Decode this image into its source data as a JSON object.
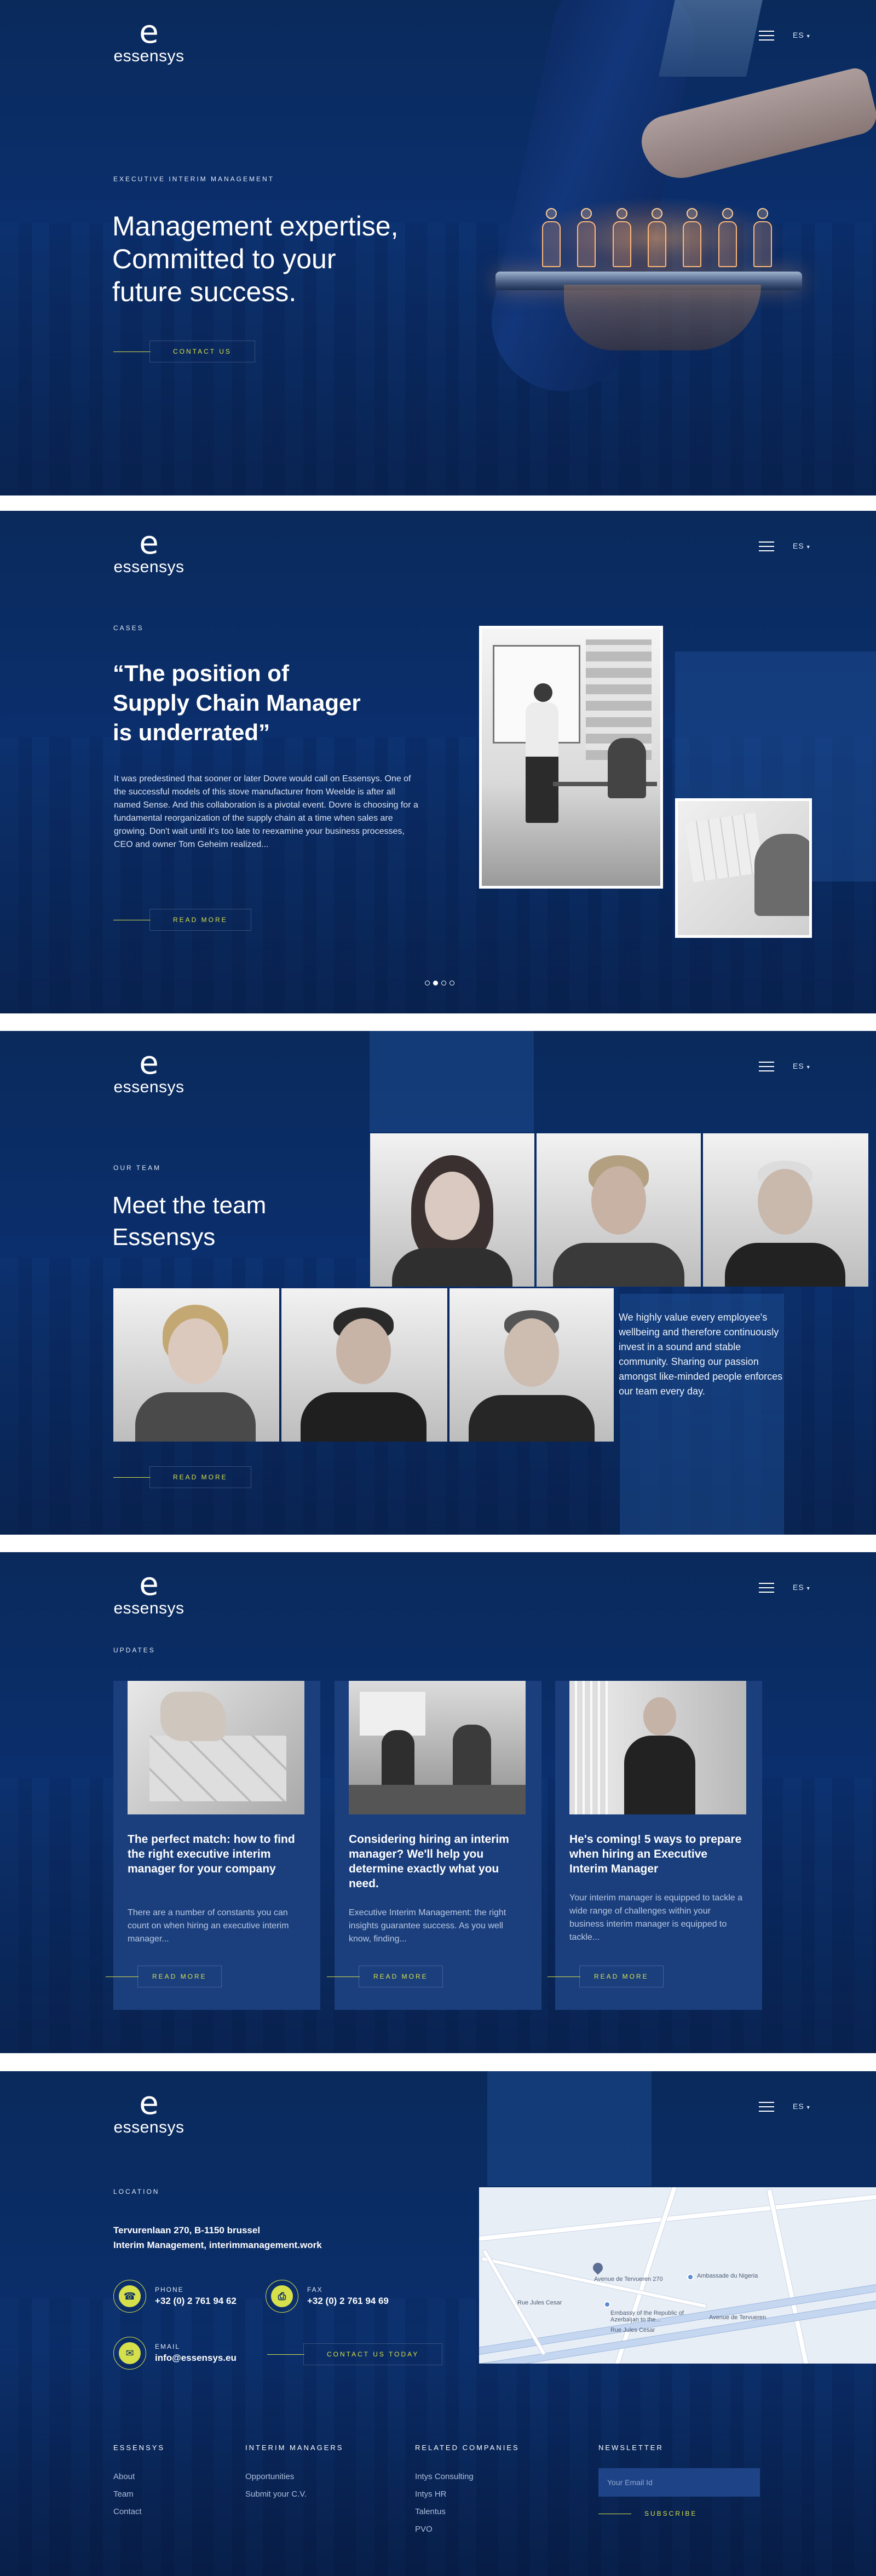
{
  "header": {
    "logo_letter": "e",
    "logo_word": "essensys",
    "lang": "ES"
  },
  "hero": {
    "eyebrow": "EXECUTIVE INTERIM MANAGEMENT",
    "headline_lines": [
      "Management expertise,",
      "Committed to your",
      "future success."
    ],
    "cta": "CONTACT US"
  },
  "cases": {
    "eyebrow": "CASES",
    "headline_lines": [
      "“The position of",
      "Supply Chain Manager",
      "is underrated”"
    ],
    "body": "It was predestined that sooner or later Dovre would call on Essensys. One of the successful models of this stove manufacturer from Weelde is after all named Sense. And this collaboration is a pivotal event. Dovre is choosing for a fundamental reorganization of the supply chain at a time when sales are growing. Don't wait until it's too late to reexamine your business processes, CEO and owner Tom Geheim realized...",
    "cta": "READ MORE",
    "slides": 4,
    "active_slide": 1
  },
  "team": {
    "eyebrow": "OUR TEAM",
    "headline_lines": [
      "Meet the team",
      "Essensys"
    ],
    "text": "We highly value every employee's wellbeing and therefore continuously invest in a sound and stable community. Sharing our passion amongst like-minded people enforces our team every day.",
    "cta": "READ MORE"
  },
  "updates": {
    "eyebrow": "UPDATES",
    "cards": [
      {
        "title": "The perfect match: how to find the right executive interim manager for your company",
        "text": "There are a number of constants you can count on when hiring an executive interim manager...",
        "cta": "READ MORE",
        "image": "puzzle-pieces"
      },
      {
        "title": "Considering hiring an interim manager? We'll help you determine exactly what you need.",
        "text": "Executive Interim Management: the right insights guarantee success. As you well know, finding...",
        "cta": "READ MORE",
        "image": "office-meeting"
      },
      {
        "title": "He's coming! 5 ways to prepare when hiring an Executive Interim Manager",
        "text": "Your interim manager is equipped to tackle a wide range of challenges within your business interim manager is equipped to tackle...",
        "cta": "READ MORE",
        "image": "businessman-portrait"
      }
    ]
  },
  "contact": {
    "eyebrow": "LOCATION",
    "address_lines": [
      "Tervurenlaan 270, B-1150 brussel",
      "Interim Management, interimmanagement.work"
    ],
    "phone_label": "PHONE",
    "phone": "+32 (0) 2 761 94 62",
    "fax_label": "FAX",
    "fax": "+32 (0) 2 761 94 69",
    "email_label": "EMAIL",
    "email": "info@essensys.eu",
    "cta": "CONTACT US TODAY",
    "map_labels": [
      "Avenue de Tervueren 270",
      "Ambassade du Nigeria",
      "Embassy of the Republic of Azerbaijan to the...",
      "Rue Jules Cesar",
      "Avenue de Tervueren",
      "Rue Jules Cesar"
    ]
  },
  "footer": {
    "col1": {
      "head": "ESSENSYS",
      "links": [
        "About",
        "Team",
        "Contact"
      ]
    },
    "col2": {
      "head": "INTERIM MANAGERS",
      "links": [
        "Opportunities",
        "Submit your C.V."
      ]
    },
    "col3": {
      "head": "RELATED COMPANIES",
      "links": [
        "Intys Consulting",
        "Intys HR",
        "Talentus",
        "PVO"
      ]
    },
    "col4": {
      "head": "NEWSLETTER",
      "placeholder": "Your Email Id",
      "cta": "SUBSCRIBE"
    }
  },
  "colors": {
    "accent": "#d6e04b",
    "background": "#0b2f6d",
    "card": "#1b3f7d"
  }
}
